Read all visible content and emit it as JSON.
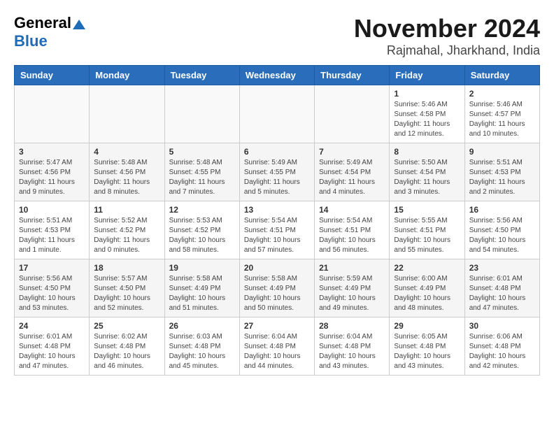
{
  "logo": {
    "line1": "General",
    "line2": "Blue"
  },
  "header": {
    "month": "November 2024",
    "location": "Rajmahal, Jharkhand, India"
  },
  "weekdays": [
    "Sunday",
    "Monday",
    "Tuesday",
    "Wednesday",
    "Thursday",
    "Friday",
    "Saturday"
  ],
  "weeks": [
    [
      {
        "day": "",
        "info": ""
      },
      {
        "day": "",
        "info": ""
      },
      {
        "day": "",
        "info": ""
      },
      {
        "day": "",
        "info": ""
      },
      {
        "day": "",
        "info": ""
      },
      {
        "day": "1",
        "info": "Sunrise: 5:46 AM\nSunset: 4:58 PM\nDaylight: 11 hours and 12 minutes."
      },
      {
        "day": "2",
        "info": "Sunrise: 5:46 AM\nSunset: 4:57 PM\nDaylight: 11 hours and 10 minutes."
      }
    ],
    [
      {
        "day": "3",
        "info": "Sunrise: 5:47 AM\nSunset: 4:56 PM\nDaylight: 11 hours and 9 minutes."
      },
      {
        "day": "4",
        "info": "Sunrise: 5:48 AM\nSunset: 4:56 PM\nDaylight: 11 hours and 8 minutes."
      },
      {
        "day": "5",
        "info": "Sunrise: 5:48 AM\nSunset: 4:55 PM\nDaylight: 11 hours and 7 minutes."
      },
      {
        "day": "6",
        "info": "Sunrise: 5:49 AM\nSunset: 4:55 PM\nDaylight: 11 hours and 5 minutes."
      },
      {
        "day": "7",
        "info": "Sunrise: 5:49 AM\nSunset: 4:54 PM\nDaylight: 11 hours and 4 minutes."
      },
      {
        "day": "8",
        "info": "Sunrise: 5:50 AM\nSunset: 4:54 PM\nDaylight: 11 hours and 3 minutes."
      },
      {
        "day": "9",
        "info": "Sunrise: 5:51 AM\nSunset: 4:53 PM\nDaylight: 11 hours and 2 minutes."
      }
    ],
    [
      {
        "day": "10",
        "info": "Sunrise: 5:51 AM\nSunset: 4:53 PM\nDaylight: 11 hours and 1 minute."
      },
      {
        "day": "11",
        "info": "Sunrise: 5:52 AM\nSunset: 4:52 PM\nDaylight: 11 hours and 0 minutes."
      },
      {
        "day": "12",
        "info": "Sunrise: 5:53 AM\nSunset: 4:52 PM\nDaylight: 10 hours and 58 minutes."
      },
      {
        "day": "13",
        "info": "Sunrise: 5:54 AM\nSunset: 4:51 PM\nDaylight: 10 hours and 57 minutes."
      },
      {
        "day": "14",
        "info": "Sunrise: 5:54 AM\nSunset: 4:51 PM\nDaylight: 10 hours and 56 minutes."
      },
      {
        "day": "15",
        "info": "Sunrise: 5:55 AM\nSunset: 4:51 PM\nDaylight: 10 hours and 55 minutes."
      },
      {
        "day": "16",
        "info": "Sunrise: 5:56 AM\nSunset: 4:50 PM\nDaylight: 10 hours and 54 minutes."
      }
    ],
    [
      {
        "day": "17",
        "info": "Sunrise: 5:56 AM\nSunset: 4:50 PM\nDaylight: 10 hours and 53 minutes."
      },
      {
        "day": "18",
        "info": "Sunrise: 5:57 AM\nSunset: 4:50 PM\nDaylight: 10 hours and 52 minutes."
      },
      {
        "day": "19",
        "info": "Sunrise: 5:58 AM\nSunset: 4:49 PM\nDaylight: 10 hours and 51 minutes."
      },
      {
        "day": "20",
        "info": "Sunrise: 5:58 AM\nSunset: 4:49 PM\nDaylight: 10 hours and 50 minutes."
      },
      {
        "day": "21",
        "info": "Sunrise: 5:59 AM\nSunset: 4:49 PM\nDaylight: 10 hours and 49 minutes."
      },
      {
        "day": "22",
        "info": "Sunrise: 6:00 AM\nSunset: 4:49 PM\nDaylight: 10 hours and 48 minutes."
      },
      {
        "day": "23",
        "info": "Sunrise: 6:01 AM\nSunset: 4:48 PM\nDaylight: 10 hours and 47 minutes."
      }
    ],
    [
      {
        "day": "24",
        "info": "Sunrise: 6:01 AM\nSunset: 4:48 PM\nDaylight: 10 hours and 47 minutes."
      },
      {
        "day": "25",
        "info": "Sunrise: 6:02 AM\nSunset: 4:48 PM\nDaylight: 10 hours and 46 minutes."
      },
      {
        "day": "26",
        "info": "Sunrise: 6:03 AM\nSunset: 4:48 PM\nDaylight: 10 hours and 45 minutes."
      },
      {
        "day": "27",
        "info": "Sunrise: 6:04 AM\nSunset: 4:48 PM\nDaylight: 10 hours and 44 minutes."
      },
      {
        "day": "28",
        "info": "Sunrise: 6:04 AM\nSunset: 4:48 PM\nDaylight: 10 hours and 43 minutes."
      },
      {
        "day": "29",
        "info": "Sunrise: 6:05 AM\nSunset: 4:48 PM\nDaylight: 10 hours and 43 minutes."
      },
      {
        "day": "30",
        "info": "Sunrise: 6:06 AM\nSunset: 4:48 PM\nDaylight: 10 hours and 42 minutes."
      }
    ]
  ]
}
